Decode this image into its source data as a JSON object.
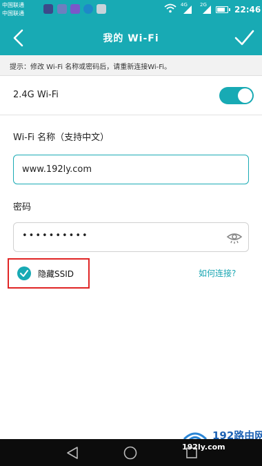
{
  "status_bar": {
    "carrier_line1": "中国联通",
    "carrier_line2": "中国联通",
    "network1": "4G",
    "network2": "2G",
    "time": "22:46"
  },
  "header": {
    "title": "我的 Wi-Fi",
    "back_icon": "back-arrow-icon",
    "confirm_icon": "checkmark-icon"
  },
  "tip": "提示：修改 Wi-Fi 名称或密码后，请重新连接Wi-Fi。",
  "wifi_toggle": {
    "label": "2.4G Wi-Fi",
    "enabled": true
  },
  "wifi_name": {
    "label": "Wi-Fi 名称（支持中文）",
    "value": "www.192ly.com"
  },
  "password": {
    "label": "密码",
    "masked_value": "••••••••••",
    "visibility_icon": "eye-hidden-icon"
  },
  "hide_ssid": {
    "label": "隐藏SSID",
    "checked": true
  },
  "howto_link": "如何连接?",
  "watermark": {
    "title": "192路由网",
    "url": "192ly.com"
  },
  "colors": {
    "accent": "#18aab4",
    "highlight_border": "#e02424",
    "link": "#19a6b2"
  }
}
